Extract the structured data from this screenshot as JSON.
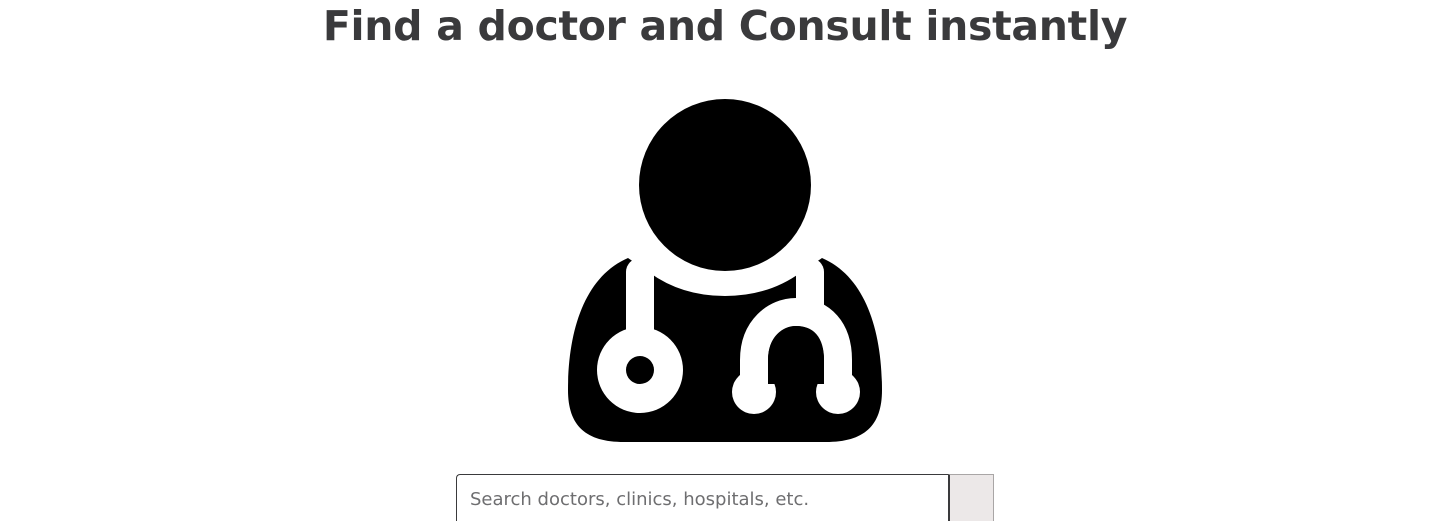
{
  "hero": {
    "title": "Find a doctor and Consult instantly",
    "icon": "doctor-stethoscope-icon"
  },
  "search": {
    "placeholder": "Search doctors, clinics, hospitals, etc.",
    "value": "",
    "button_icon": "search-icon"
  },
  "colors": {
    "heading": "#3a3a3c",
    "icon": "#000000",
    "search_button_bg": "#ece8e8"
  }
}
